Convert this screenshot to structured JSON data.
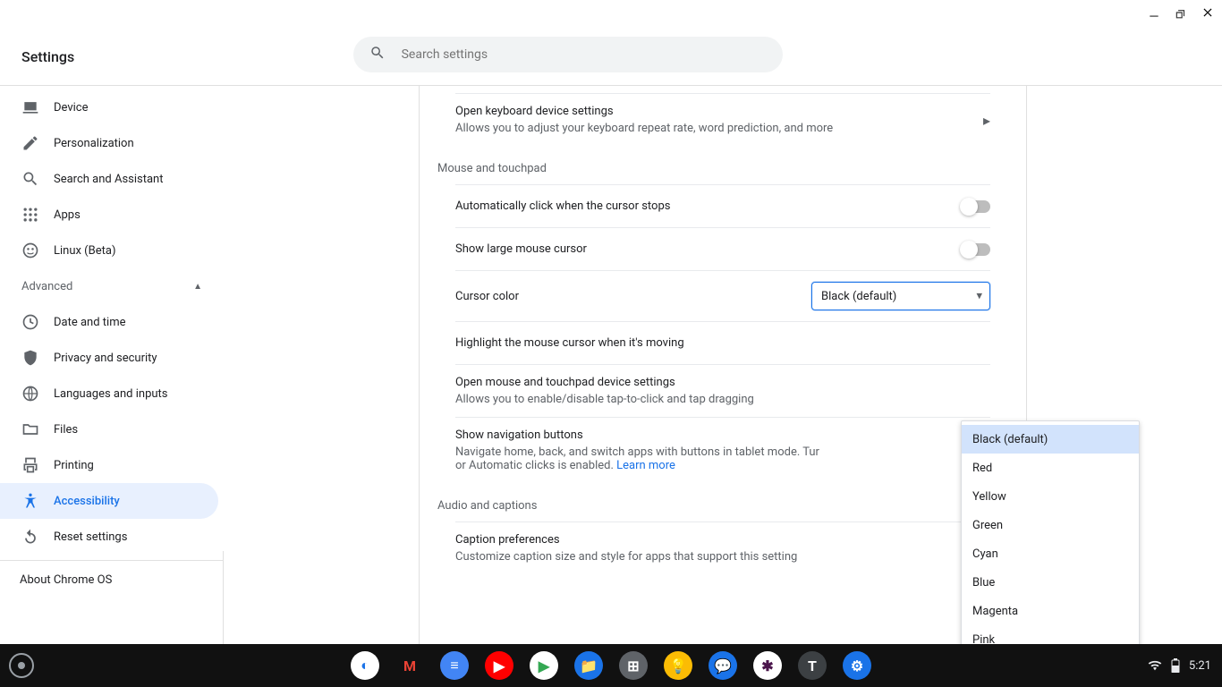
{
  "app_title": "Settings",
  "search": {
    "placeholder": "Search settings"
  },
  "sidebar": {
    "items": [
      {
        "icon": "laptop-icon",
        "label": "Device"
      },
      {
        "icon": "pencil-icon",
        "label": "Personalization"
      },
      {
        "icon": "search-icon",
        "label": "Search and Assistant"
      },
      {
        "icon": "grid-icon",
        "label": "Apps"
      },
      {
        "icon": "linux-icon",
        "label": "Linux (Beta)"
      }
    ],
    "advanced_label": "Advanced",
    "advanced_items": [
      {
        "icon": "clock-icon",
        "label": "Date and time"
      },
      {
        "icon": "shield-icon",
        "label": "Privacy and security"
      },
      {
        "icon": "globe-icon",
        "label": "Languages and inputs"
      },
      {
        "icon": "folder-icon",
        "label": "Files"
      },
      {
        "icon": "printer-icon",
        "label": "Printing"
      },
      {
        "icon": "a11y-icon",
        "label": "Accessibility",
        "active": true
      },
      {
        "icon": "reset-icon",
        "label": "Reset settings"
      }
    ],
    "about": "About Chrome OS"
  },
  "content": {
    "kb": {
      "label": "Open keyboard device settings",
      "sub": "Allows you to adjust your keyboard repeat rate, word prediction, and more"
    },
    "section_mouse": "Mouse and touchpad",
    "autoclick": {
      "label": "Automatically click when the cursor stops"
    },
    "largecursor": {
      "label": "Show large mouse cursor"
    },
    "cursorcolor": {
      "label": "Cursor color",
      "value": "Black (default)",
      "options": [
        "Black (default)",
        "Red",
        "Yellow",
        "Green",
        "Cyan",
        "Blue",
        "Magenta",
        "Pink"
      ]
    },
    "highlight": {
      "label": "Highlight the mouse cursor when it's moving"
    },
    "mousedev": {
      "label": "Open mouse and touchpad device settings",
      "sub": "Allows you to enable/disable tap-to-click and tap dragging"
    },
    "navbtn": {
      "label": "Show navigation buttons",
      "sub_a": "Navigate home, back, and switch apps with buttons in tablet mode. Tur",
      "sub_b": "or Automatic clicks is enabled.  ",
      "learn": "Learn more"
    },
    "section_audio": "Audio and captions",
    "captions": {
      "label": "Caption preferences",
      "sub": "Customize caption size and style for apps that support this setting"
    }
  },
  "shelf": {
    "time": "5:21",
    "apps": [
      {
        "name": "chrome",
        "bg": "#ffffff",
        "fg": "#1a73e8",
        "glyph": "◐"
      },
      {
        "name": "gmail",
        "bg": "transparent",
        "fg": "#ea4335",
        "glyph": "M"
      },
      {
        "name": "docs",
        "bg": "#4285f4",
        "fg": "#ffffff",
        "glyph": "≡"
      },
      {
        "name": "youtube",
        "bg": "#ff0000",
        "fg": "#ffffff",
        "glyph": "▶"
      },
      {
        "name": "play",
        "bg": "#ffffff",
        "fg": "#34a853",
        "glyph": "▶"
      },
      {
        "name": "files",
        "bg": "#1a73e8",
        "fg": "#ffffff",
        "glyph": "📁"
      },
      {
        "name": "calc",
        "bg": "#5f6368",
        "fg": "#ffffff",
        "glyph": "⊞"
      },
      {
        "name": "keep",
        "bg": "#fbbc04",
        "fg": "#ffffff",
        "glyph": "💡"
      },
      {
        "name": "messages",
        "bg": "#1a73e8",
        "fg": "#ffffff",
        "glyph": "💬"
      },
      {
        "name": "slack",
        "bg": "#ffffff",
        "fg": "#4a154b",
        "glyph": "✱"
      },
      {
        "name": "text",
        "bg": "#3c4043",
        "fg": "#ffffff",
        "glyph": "T"
      },
      {
        "name": "settings",
        "bg": "#1a73e8",
        "fg": "#ffffff",
        "glyph": "⚙"
      }
    ]
  }
}
